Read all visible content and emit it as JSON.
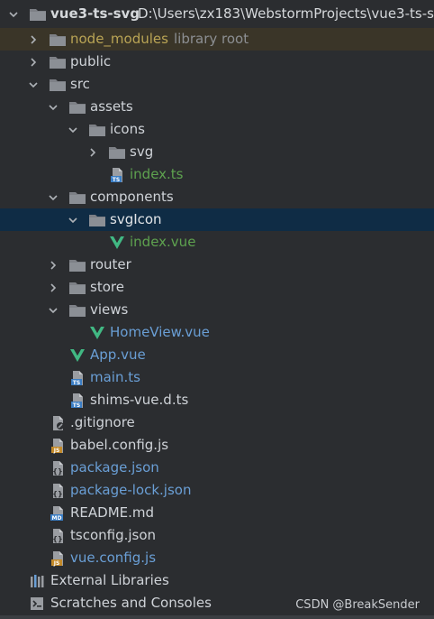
{
  "project": {
    "name": "vue3-ts-svg",
    "path": "D:\\Users\\zx183\\WebstormProjects\\vue3-ts-s"
  },
  "tree": {
    "node_modules": "node_modules",
    "library_root": "library root",
    "public": "public",
    "src": "src",
    "assets": "assets",
    "icons": "icons",
    "svg": "svg",
    "index_ts": "index.ts",
    "components": "components",
    "svgicon": "svgIcon",
    "index_vue": "index.vue",
    "router": "router",
    "store": "store",
    "views": "views",
    "homeview": "HomeView.vue",
    "app_vue": "App.vue",
    "main_ts": "main.ts",
    "shims": "shims-vue.d.ts",
    "gitignore": ".gitignore",
    "babel": "babel.config.js",
    "package_json": "package.json",
    "package_lock": "package-lock.json",
    "readme": "README.md",
    "tsconfig": "tsconfig.json",
    "vue_config": "vue.config.js",
    "external_libraries": "External Libraries",
    "scratches": "Scratches and Consoles"
  },
  "watermark": "CSDN @BreakSender",
  "colors": {
    "background": "#2b2d30",
    "selected_row": "#0f2c45",
    "library_row": "#3a3528",
    "text": "#cfd3d8",
    "vue_green": "#41b883",
    "ts_blue": "#3b7ec5",
    "folder": "#7d8086"
  },
  "icons": {
    "folder": "folder-icon",
    "ts": "ts-file-icon",
    "vue": "vue-file-icon",
    "js": "js-file-icon",
    "json": "json-file-icon",
    "md": "md-file-icon",
    "git": "gitignore-file-icon"
  }
}
